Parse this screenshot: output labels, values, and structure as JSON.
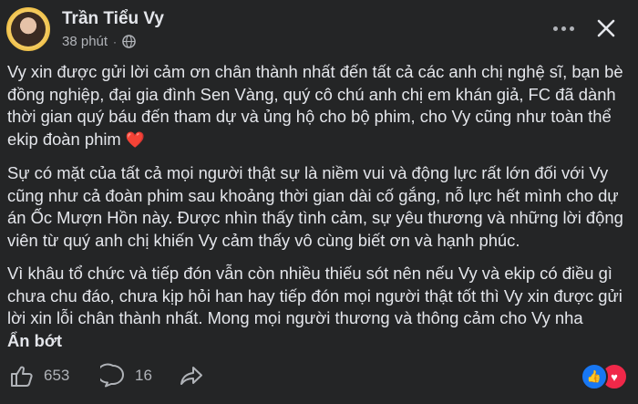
{
  "post": {
    "author": "Trần Tiểu Vy",
    "time": "38 phút",
    "separator": "·",
    "paragraphs": [
      "Vy xin được gửi lời cảm ơn chân thành nhất đến tất cả các anh chị nghệ sĩ, bạn bè đồng nghiệp, đại gia đình Sen Vàng, quý cô chú anh chị em khán giả, FC đã dành thời gian quý báu đến tham dự và ủng hộ cho bộ phim, cho Vy cũng như toàn thể ekip đoàn phim",
      "Sự có mặt của tất cả mọi người thật sự là niềm vui và động lực rất lớn đối với Vy cũng như cả đoàn phim sau khoảng thời gian dài cố gắng, nỗ lực hết mình cho dự án Ốc Mượn Hồn này. Được nhìn thấy tình cảm, sự yêu thương và những lời động viên từ quý anh chị khiến Vy cảm thấy vô cùng biết ơn và hạnh phúc.",
      "Vì khâu tổ chức và tiếp đón vẫn còn nhiều thiếu sót nên nếu Vy và ekip có điều gì chưa chu đáo, chưa kịp hỏi han hay tiếp đón mọi người thật tốt thì Vy xin được gửi lời xin lỗi chân thành nhất. Mong mọi người thương và thông cảm cho Vy nha"
    ],
    "heart_emoji": "❤️",
    "see_less": "Ẩn bớt"
  },
  "actions": {
    "likes": "653",
    "comments": "16"
  },
  "icons": {
    "privacy": "globe-icon",
    "more": "more-options-icon",
    "close": "close-icon",
    "like": "thumbs-up-icon",
    "comment": "comment-icon",
    "share": "share-icon"
  },
  "colors": {
    "background": "#242526",
    "text": "#e4e6eb",
    "secondary": "#b0b3b8",
    "like_blue": "#1877f2",
    "love_red": "#f02849"
  }
}
